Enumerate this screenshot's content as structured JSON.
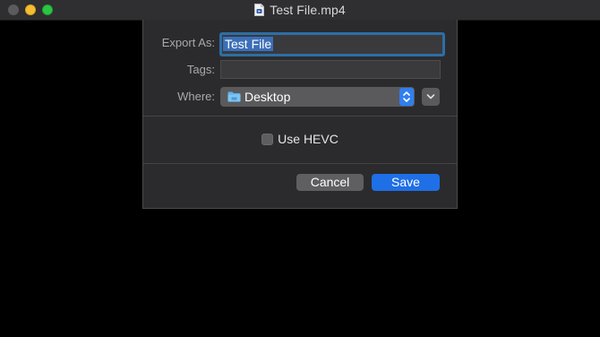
{
  "window": {
    "title": "Test File.mp4"
  },
  "dialog": {
    "export_as": {
      "label": "Export As:",
      "value": "Test File"
    },
    "tags": {
      "label": "Tags:",
      "value": ""
    },
    "where": {
      "label": "Where:",
      "selected": "Desktop",
      "icon": "folder-icon"
    },
    "options": {
      "use_hevc_label": "Use HEVC",
      "use_hevc_checked": false
    },
    "buttons": {
      "cancel": "Cancel",
      "save": "Save"
    }
  },
  "colors": {
    "accent": "#1f6fe6",
    "focus_ring": "#2d6ea6",
    "selection": "#3b6fb8",
    "sheet_bg": "#2b2b2d",
    "traffic_minimize": "#f5bd30",
    "traffic_zoom": "#2bc641",
    "traffic_close_inactive": "#5b5b5e"
  }
}
